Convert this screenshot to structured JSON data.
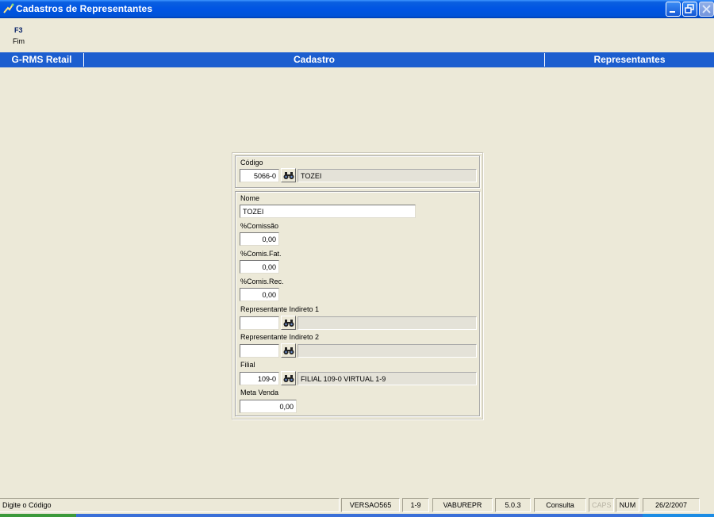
{
  "window": {
    "title": "Cadastros de Representantes",
    "icon": "app-window-icon",
    "controls": [
      "minimize-icon",
      "restore-icon",
      "close-icon"
    ]
  },
  "menu": {
    "key": "F3",
    "label": "Fim"
  },
  "header": {
    "module": "G-RMS Retail",
    "section": "Cadastro",
    "entity": "Representantes"
  },
  "form": {
    "codigo": {
      "label": "Código",
      "value": "5066-0",
      "description": "TOZEI"
    },
    "nome": {
      "label": "Nome",
      "value": "TOZEI"
    },
    "comissao": {
      "label": "%Comissão",
      "value": "0,00"
    },
    "comis_fat": {
      "label": "%Comis.Fat.",
      "value": "0,00"
    },
    "comis_rec": {
      "label": "%Comis.Rec.",
      "value": "0,00"
    },
    "rep_indireto_1": {
      "label": "Representante Indireto 1",
      "value": "",
      "description": ""
    },
    "rep_indireto_2": {
      "label": "Representante Indireto 2",
      "value": "",
      "description": ""
    },
    "filial": {
      "label": "Filial",
      "value": "109-0",
      "description": "FILIAL 109-0 VIRTUAL 1-9"
    },
    "meta_venda": {
      "label": "Meta Venda",
      "value": "0,00"
    }
  },
  "statusbar": {
    "message": "Digite o Código",
    "version": "VERSAO565",
    "branch": "1-9",
    "program": "VABUREPR",
    "release": "5.0.3",
    "mode": "Consulta",
    "caps": "CAPS",
    "num": "NUM",
    "date": "26/2/2007"
  },
  "colors": {
    "titlebar": "#0054E3",
    "header_band": "#1C5ECF",
    "background": "#ECE9D8",
    "menu_key": "#0A246A"
  }
}
